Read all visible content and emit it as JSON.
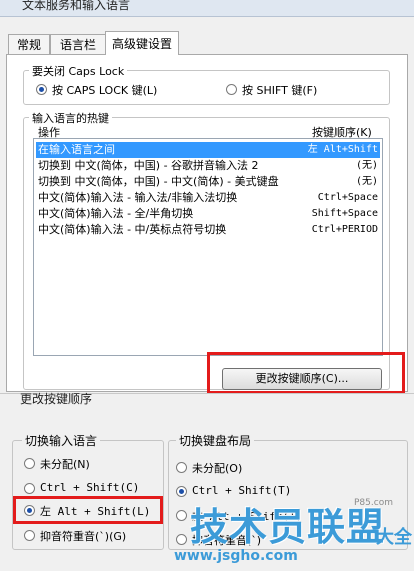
{
  "window": {
    "title": "文本服务和输入语言"
  },
  "tabs": [
    {
      "label": "常规"
    },
    {
      "label": "语言栏"
    },
    {
      "label": "高级键设置"
    }
  ],
  "caps_lock": {
    "legend": "要关闭 Caps Lock",
    "option_capslock": "按 CAPS LOCK 键(L)",
    "option_shift": "按 SHIFT 键(F)",
    "selected": "capslock"
  },
  "hotkeys": {
    "legend": "输入语言的热键",
    "col_action": "操作",
    "col_sequence": "按键顺序(K)",
    "rows": [
      {
        "action": "在输入语言之间",
        "keys": "左 Alt+Shift"
      },
      {
        "action": "切换到 中文(简体，中国) - 谷歌拼音输入法 2",
        "keys": "(无)"
      },
      {
        "action": "切换到 中文(简体，中国) - 中文(简体) - 美式键盘",
        "keys": "(无)"
      },
      {
        "action": "中文(简体)输入法 - 输入法/非输入法切换",
        "keys": "Ctrl+Space"
      },
      {
        "action": "中文(简体)输入法 - 全/半角切换",
        "keys": "Shift+Space"
      },
      {
        "action": "中文(简体)输入法 - 中/英标点符号切换",
        "keys": "Ctrl+PERIOD"
      }
    ],
    "change_button": "更改按键顺序(C)..."
  },
  "change_dialog": {
    "title": "更改按键顺序",
    "switch_language": {
      "legend": "切换输入语言",
      "options": [
        "未分配(N)",
        "Ctrl + Shift(C)",
        "左 Alt + Shift(L)",
        "抑音符重音(`)(G)"
      ],
      "selected_index": 2
    },
    "switch_layout": {
      "legend": "切换键盘布局",
      "options": [
        "未分配(O)",
        "Ctrl + Shift(T)",
        "左 Alt + Shift(I)",
        "抑音符重音(`)"
      ],
      "selected_index": 1
    }
  },
  "watermark": {
    "text": "技术员联盟",
    "url": "www.jsgho.com",
    "suffix": "大全",
    "small": "P85.com"
  },
  "colors": {
    "selection": "#3399ff",
    "highlight_box": "#e31b1b",
    "watermark": "#3c9bd8"
  }
}
